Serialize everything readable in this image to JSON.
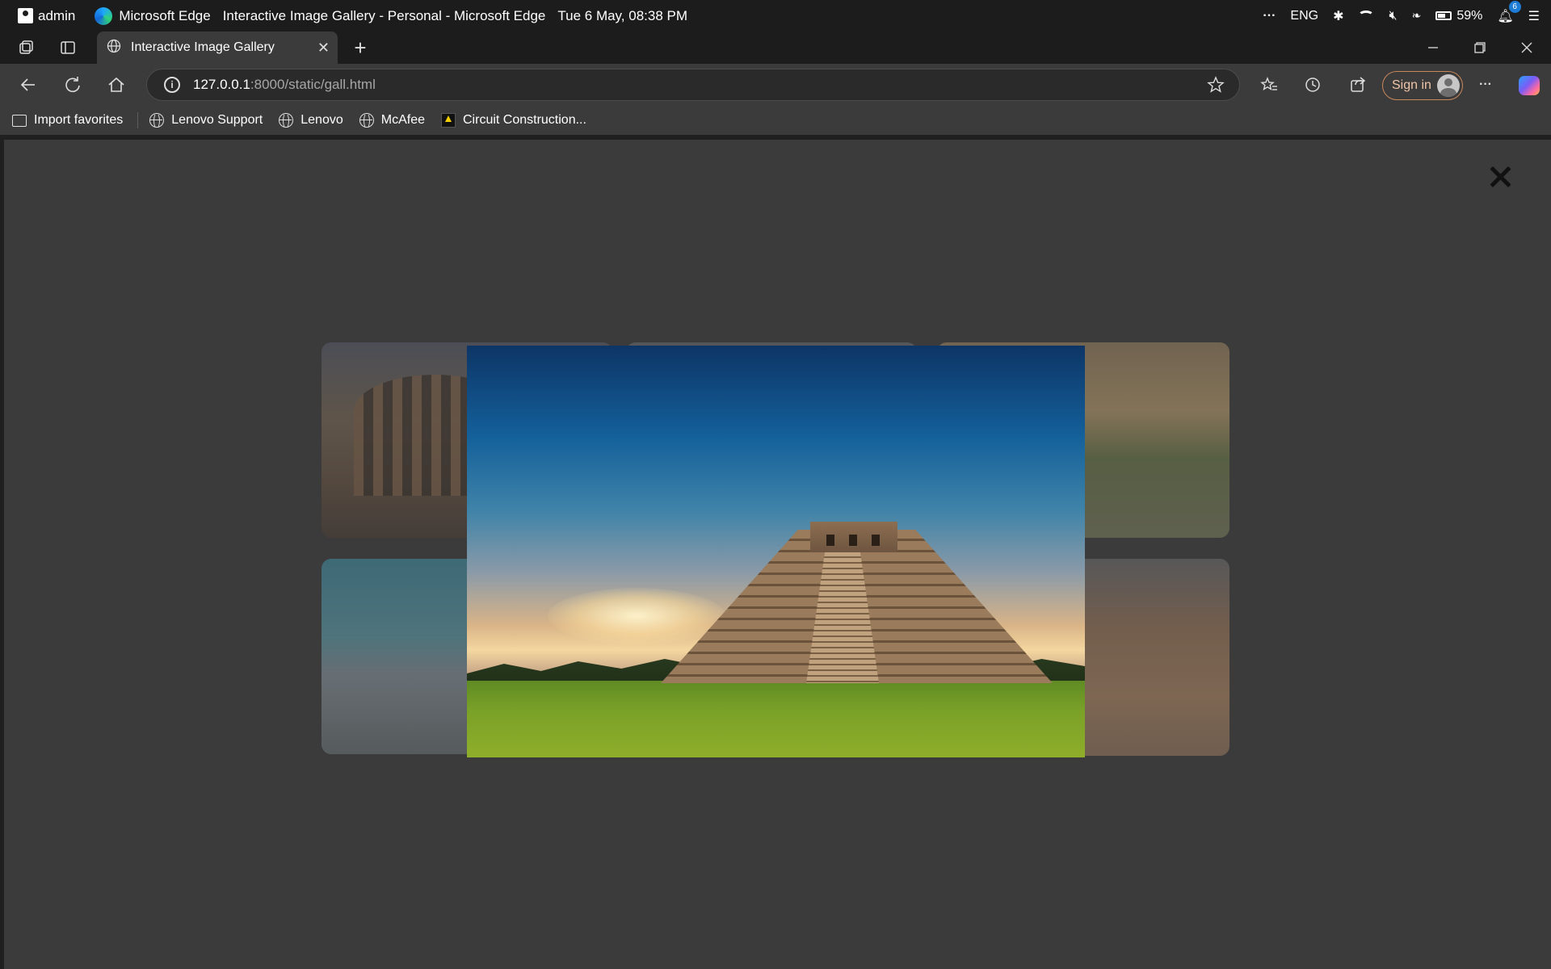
{
  "taskbar": {
    "user": "admin",
    "app": "Microsoft Edge",
    "window_title": "Interactive Image Gallery - Personal - Microsoft Edge",
    "datetime": "Tue 6 May, 08:38 PM",
    "overflow": "···",
    "language": "ENG",
    "battery": "59%",
    "notification_count": "6"
  },
  "tabs": [
    {
      "title": "Interactive Image Gallery"
    }
  ],
  "address": {
    "host": "127.0.0.1",
    "path": ":8000/static/gall.html"
  },
  "toolbar": {
    "signin_label": "Sign in",
    "more": "···"
  },
  "favorites": [
    {
      "label": "Import favorites",
      "icon": "import-icon"
    },
    {
      "label": "Lenovo Support",
      "icon": "globe-icon"
    },
    {
      "label": "Lenovo",
      "icon": "globe-icon"
    },
    {
      "label": "McAfee",
      "icon": "globe-icon"
    },
    {
      "label": "Circuit Construction...",
      "icon": "phet-icon"
    }
  ],
  "gallery": {
    "lightbox_open": true,
    "thumbnails": [
      "colosseum",
      "unknown",
      "taj-mahal",
      "coastal-city",
      "unknown",
      "petra"
    ],
    "lightbox_image": "chichen-itza-pyramid"
  },
  "colors": {
    "page_bg": "#3b3b3b",
    "chrome_bg": "#1c1c1c",
    "signin_border": "#c8875a"
  }
}
